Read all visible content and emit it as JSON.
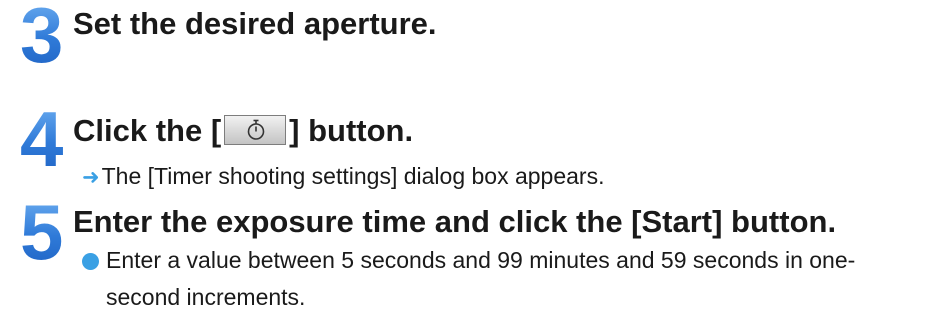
{
  "steps": [
    {
      "number": "3",
      "heading": "Set the desired aperture."
    },
    {
      "number": "4",
      "heading_before": "Click the [",
      "heading_after": "] button.",
      "button_icon": "timer-icon",
      "result": "The [Timer shooting settings] dialog box appears."
    },
    {
      "number": "5",
      "heading": "Enter the exposure time and click the [Start] button.",
      "bullet": "Enter a value between 5 seconds and 99 minutes and 59 seconds in one-second increments."
    }
  ],
  "colors": {
    "step_number": "#2f7ad8",
    "arrow": "#3aa0e4",
    "bullet": "#3aa0e4",
    "text": "#1a1a1a"
  }
}
